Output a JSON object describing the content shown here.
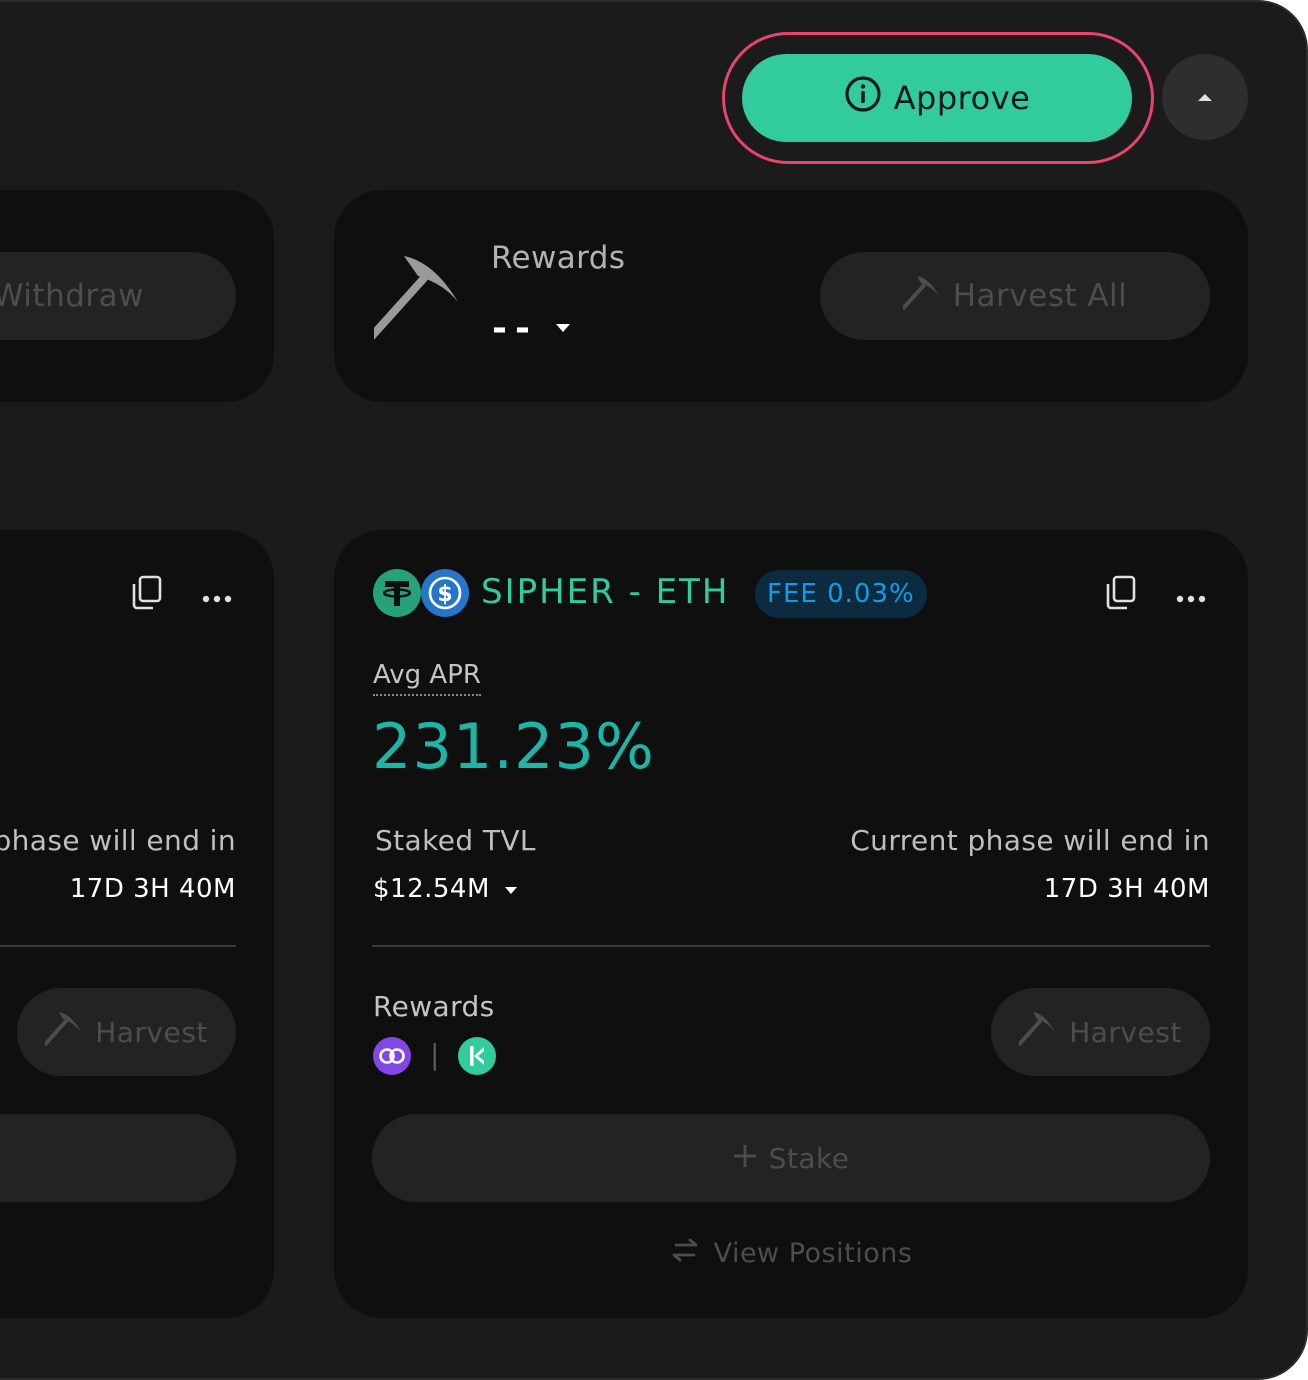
{
  "header": {
    "approve_label": "Approve"
  },
  "top_left_card": {
    "withdraw_label": "Withdraw"
  },
  "rewards_summary": {
    "label": "Rewards",
    "value": "--",
    "harvest_all_label": "Harvest All"
  },
  "left_farm_card": {
    "phase_label": "phase will end in",
    "phase_value": "17D 3H 40M",
    "harvest_label": "Harvest"
  },
  "farm_card": {
    "pair_name": "SIPHER - ETH",
    "fee_badge": "FEE 0.03%",
    "apr_label": "Avg APR",
    "apr_value": "231.23%",
    "tvl_label": "Staked TVL",
    "tvl_value": "$12.54M",
    "phase_label": "Current phase will end in",
    "phase_value": "17D 3H 40M",
    "rewards_label": "Rewards",
    "reward_separator": "|",
    "harvest_label": "Harvest",
    "stake_label": "Stake",
    "view_positions_label": "View Positions"
  },
  "icons": {
    "pair_token_1": "usdt-token-icon",
    "pair_token_2": "usdc-token-icon",
    "reward_token_1": "matic-token-icon",
    "reward_token_2": "knc-token-icon"
  },
  "colors": {
    "accent_green": "#31cb9e",
    "apr_teal": "#1fb5a6",
    "fee_blue": "#08a1e7",
    "highlight_ring": "#e8456a"
  }
}
